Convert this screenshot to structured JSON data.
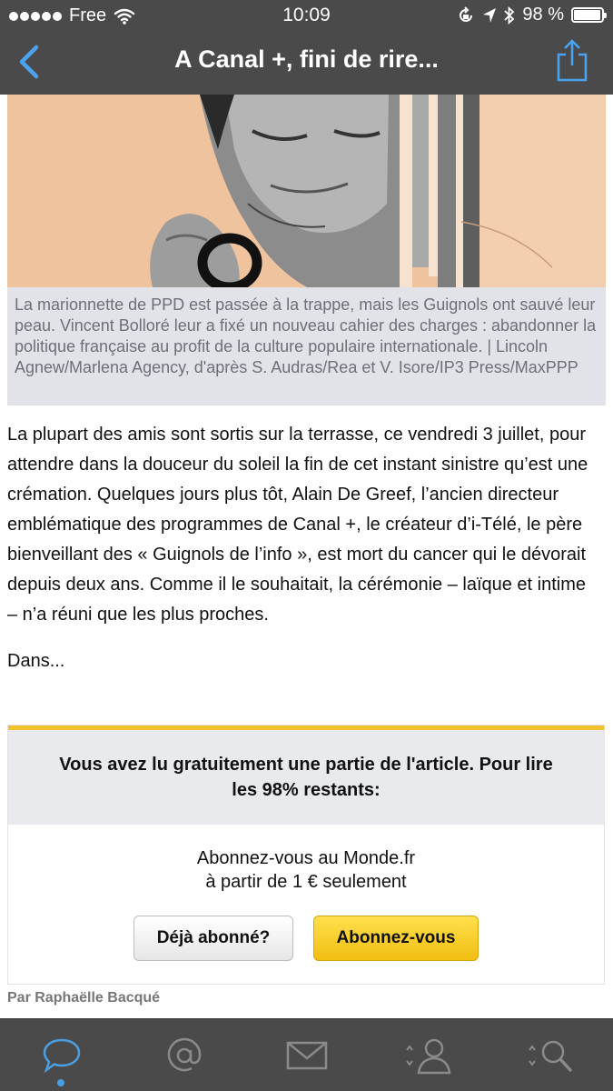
{
  "status_bar": {
    "carrier": "Free",
    "time": "10:09",
    "battery_text": "98 %",
    "battery_level": 0.98
  },
  "nav": {
    "title": "A Canal +, fini de rire...",
    "back_icon": "chevron-left-icon",
    "share_icon": "share-icon"
  },
  "caption": "La marionnette de PPD est passée à la trappe, mais les Guignols ont sauvé leur peau. Vincent Bolloré leur a fixé un nouveau cahier des charges : abandonner la politique française au profit de la culture populaire internationale. | Lincoln Agnew/Marlena Agency, d'après S. Audras/Rea et V. Isore/IP3 Press/MaxPPP",
  "article": {
    "paragraph1": "La plupart des amis sont sortis sur la terrasse, ce vendredi 3 juillet, pour attendre dans la douceur du soleil la fin de cet instant sinistre qu’est une crémation. Quelques jours plus tôt, Alain De Greef, l’ancien directeur emblématique des programmes de Canal +, le créateur d’i-Télé, le père bienveillant des « Guignols de l’info », est mort du cancer qui le dévorait depuis deux ans. Comme il le souhaitait, la cérémonie – laïque et intime – n’a réuni que les plus proches.",
    "paragraph2": "Dans..."
  },
  "paywall": {
    "message": "Vous avez lu gratuitement une partie de l'article. Pour lire les 98% restants:",
    "offer_line1": "Abonnez-vous au Monde.fr",
    "offer_line2": "à partir de 1 € seulement",
    "already_subscribed_label": "Déjà abonné?",
    "subscribe_label": "Abonnez-vous",
    "accent_color": "#f2c12e"
  },
  "byline": "Par Raphaëlle Bacqué",
  "tabbar": {
    "tabs": [
      "speech-bubble-icon",
      "at-sign-icon",
      "envelope-icon",
      "person-icon",
      "search-icon"
    ],
    "active_index": 0,
    "active_color": "#4a9fe3"
  }
}
